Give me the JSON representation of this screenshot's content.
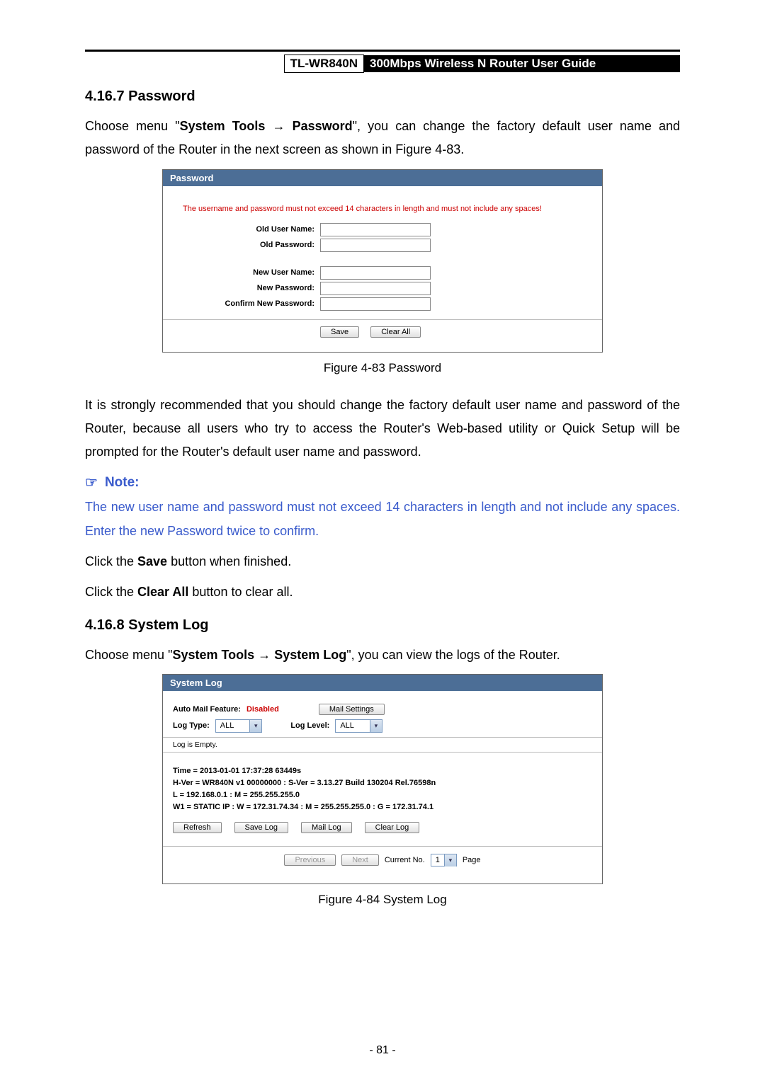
{
  "header": {
    "model": "TL-WR840N",
    "title": "300Mbps Wireless N Router User Guide"
  },
  "section1": {
    "heading": "4.16.7 Password",
    "intro_pre": "Choose menu \"",
    "intro_b1": "System Tools",
    "intro_arrow": " → ",
    "intro_b2": "Password",
    "intro_post": "\", you can change the factory default user name and password of the Router in the next screen as shown in Figure 4-83.",
    "fig_caption": "Figure 4-83    Password",
    "para2": "It is strongly recommended that you should change the factory default user name and password of the Router, because all users who try to access the Router's Web-based utility or Quick Setup will be prompted for the Router's default user name and password.",
    "note_label": "Note:",
    "note_body": "The new user name and password must not exceed 14 characters in length and not include any spaces. Enter the new Password twice to confirm.",
    "p_save_pre": "Click the ",
    "p_save_b": "Save",
    "p_save_post": " button when finished.",
    "p_clear_pre": "Click the ",
    "p_clear_b": "Clear All",
    "p_clear_post": " button to clear all."
  },
  "password_panel": {
    "title": "Password",
    "warning": "The username and password must not exceed 14 characters in length and must not include any spaces!",
    "old_user": "Old User Name:",
    "old_pass": "Old Password:",
    "new_user": "New User Name:",
    "new_pass": "New Password:",
    "confirm_pass": "Confirm New Password:",
    "save_btn": "Save",
    "clear_btn": "Clear All"
  },
  "section2": {
    "heading": "4.16.8 System Log",
    "intro_pre": "Choose menu \"",
    "intro_b1": "System Tools",
    "intro_arrow": " → ",
    "intro_b2": "System Log",
    "intro_post": "\", you can view the logs of the Router.",
    "fig_caption": "Figure 4-84    System Log"
  },
  "syslog_panel": {
    "title": "System Log",
    "auto_mail_label": "Auto Mail Feature:",
    "auto_mail_value": "Disabled",
    "mail_settings_btn": "Mail Settings",
    "log_type_label": "Log Type:",
    "log_type_value": "ALL",
    "log_level_label": "Log Level:",
    "log_level_value": "ALL",
    "log_empty": "Log is Empty.",
    "info_time": "Time = 2013-01-01 17:37:28 63449s",
    "info_ver": "H-Ver = WR840N v1 00000000 : S-Ver = 3.13.27 Build 130204 Rel.76598n",
    "info_lan": "L = 192.168.0.1 : M = 255.255.255.0",
    "info_wan": "W1 = STATIC IP : W = 172.31.74.34 : M = 255.255.255.0 : G = 172.31.74.1",
    "btn_refresh": "Refresh",
    "btn_savelog": "Save Log",
    "btn_maillog": "Mail Log",
    "btn_clearlog": "Clear Log",
    "pager_prev": "Previous",
    "pager_next": "Next",
    "pager_current_label": "Current No.",
    "pager_current_value": "1",
    "pager_page": "Page"
  },
  "page_number": "- 81 -"
}
